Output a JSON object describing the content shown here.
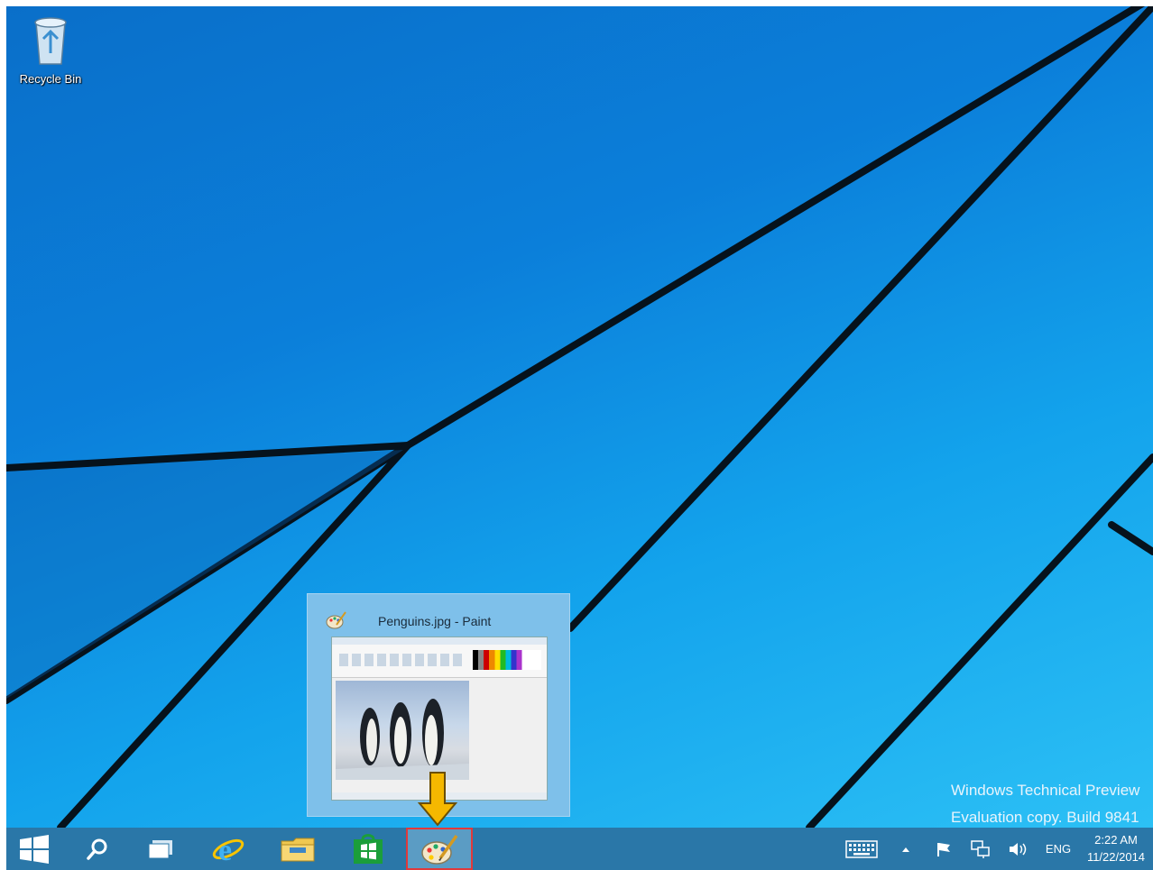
{
  "desktop": {
    "icons": [
      {
        "label": "Recycle Bin",
        "icon": "recycle-bin-icon"
      }
    ],
    "watermark": {
      "line1": "Windows Technical Preview",
      "line2": "Evaluation copy. Build 9841"
    }
  },
  "preview": {
    "title": "Penguins.jpg - Paint",
    "icon": "paint-icon"
  },
  "taskbar": {
    "buttons": [
      {
        "name": "start",
        "icon": "windows-logo-icon"
      },
      {
        "name": "search",
        "icon": "search-icon"
      },
      {
        "name": "task-view",
        "icon": "task-view-icon"
      },
      {
        "name": "internet-explorer",
        "icon": "internet-explorer-icon"
      },
      {
        "name": "file-explorer",
        "icon": "folder-icon"
      },
      {
        "name": "store",
        "icon": "store-icon"
      },
      {
        "name": "paint",
        "icon": "paint-icon",
        "active": true
      }
    ],
    "tray": {
      "keyboard_icon": "keyboard-icon",
      "chevron_icon": "chevron-up-icon",
      "flag_icon": "action-center-flag-icon",
      "network_icon": "network-icon",
      "volume_icon": "volume-icon",
      "language": "ENG",
      "time": "2:22 AM",
      "date": "11/22/2014"
    }
  },
  "colors": {
    "taskbar": "#2a77a8",
    "active_border": "#e0393b",
    "arrow": "#f5b800"
  }
}
